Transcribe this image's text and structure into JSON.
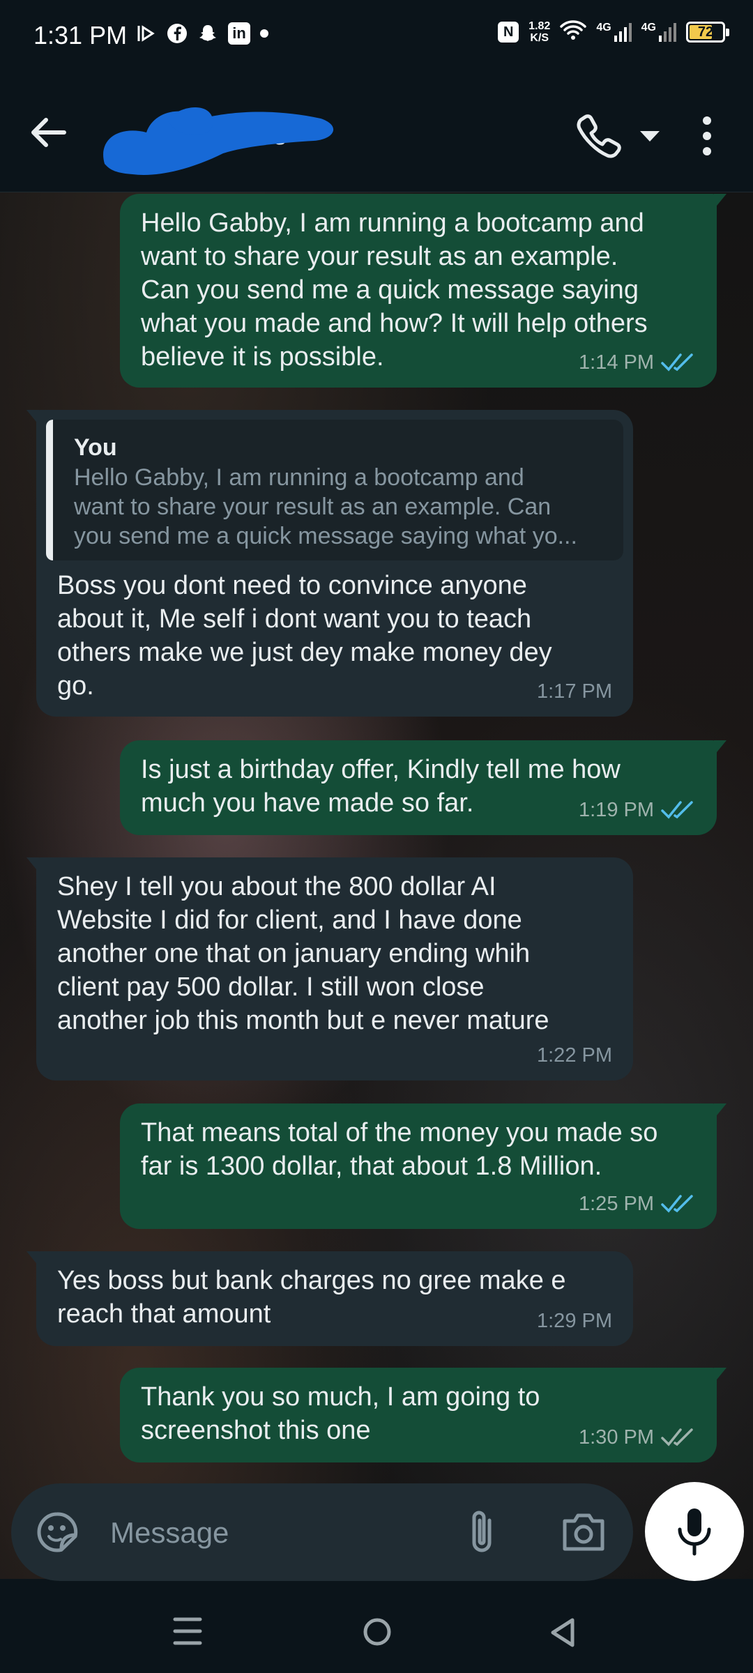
{
  "status_bar": {
    "time": "1:31 PM",
    "net_speed_value": "1.82",
    "net_speed_unit": "K/S",
    "signal1_label": "4G",
    "signal2_label": "4G",
    "battery_level": "72",
    "battery_fraction": 0.72,
    "battery_color": "#f2c94c"
  },
  "header": {
    "contact_name_visible": "e",
    "icons": [
      "back-arrow-icon",
      "phone-icon",
      "caret-down-icon",
      "more-vert-icon"
    ]
  },
  "colors": {
    "outgoing_bubble": "#144d37",
    "incoming_bubble": "#202c33",
    "read_ticks": "#53bdeb",
    "delivered_ticks": "#9fb3ad"
  },
  "messages": [
    {
      "direction": "out",
      "text": "Hello Gabby, I am running a bootcamp and\nwant to share your result as an example.\nCan you send me a quick message saying\nwhat you made and how? It will help others\nbelieve it is possible.",
      "time": "1:14 PM",
      "status": "read"
    },
    {
      "direction": "in",
      "quote_author": "You",
      "quote_text": "Hello Gabby, I am running a bootcamp and\nwant to share your result as an example. Can\nyou send me a quick message saying what yo...",
      "text": "Boss you dont need to convince anyone\nabout it, Me self i dont want you to teach\nothers make we just dey make money dey\ngo.",
      "time": "1:17 PM"
    },
    {
      "direction": "out",
      "text": "Is just a birthday offer, Kindly tell me how\nmuch you have made so far.",
      "time": "1:19 PM",
      "status": "read"
    },
    {
      "direction": "in",
      "text": "Shey I tell you about the 800 dollar AI\nWebsite I did for client, and I have done\nanother one that on january ending whih\nclient pay 500 dollar. I still won close\nanother job this month but e never mature",
      "time": "1:22 PM"
    },
    {
      "direction": "out",
      "text": "That means total of the money you made so\nfar is 1300 dollar, that about 1.8 Million.",
      "time": "1:25 PM",
      "status": "read"
    },
    {
      "direction": "in",
      "text": "Yes boss but bank charges no gree make e\nreach that amount",
      "time": "1:29 PM"
    },
    {
      "direction": "out",
      "text": "Thank you so much, I am going to\nscreenshot this one",
      "time": "1:30 PM",
      "status": "delivered"
    }
  ],
  "composer": {
    "placeholder": "Message"
  }
}
